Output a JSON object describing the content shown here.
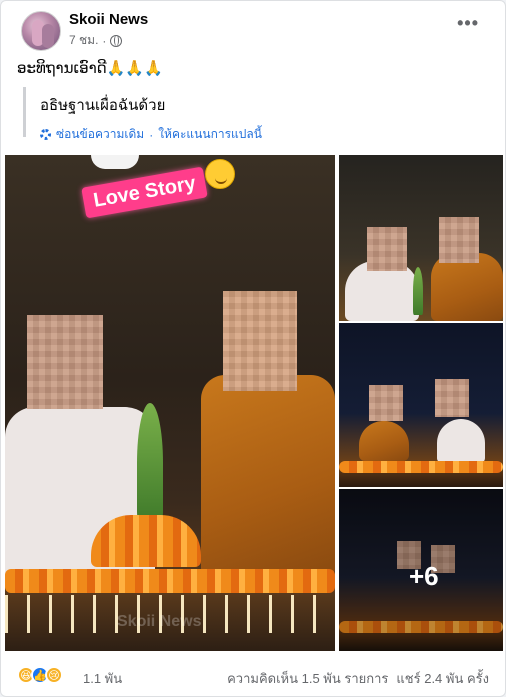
{
  "post": {
    "page_name": "Skoii News",
    "time": "7 ชม.",
    "privacy_icon": "globe-icon",
    "more_icon": "more-options-icon",
    "text": "ອະທິຖານເອົາດີ🙏🙏🙏",
    "translation": {
      "text": "อธิษฐานเผื่อฉันด้วย",
      "hide_original": "ซ่อนข้อความเดิม",
      "separator": "·",
      "rate_translation": "ให้คะแนนการแปลนี้"
    }
  },
  "photos": {
    "sticker_text": "Love Story",
    "watermark": "Skoii News",
    "more_count": "+6"
  },
  "footer": {
    "reaction_icons": [
      "haha-icon",
      "like-icon",
      "sad-icon"
    ],
    "reaction_count": "1.1 พัน",
    "comments": "ความคิดเห็น 1.5 พัน รายการ",
    "shares": "แชร์ 2.4 พัน ครั้ง"
  }
}
